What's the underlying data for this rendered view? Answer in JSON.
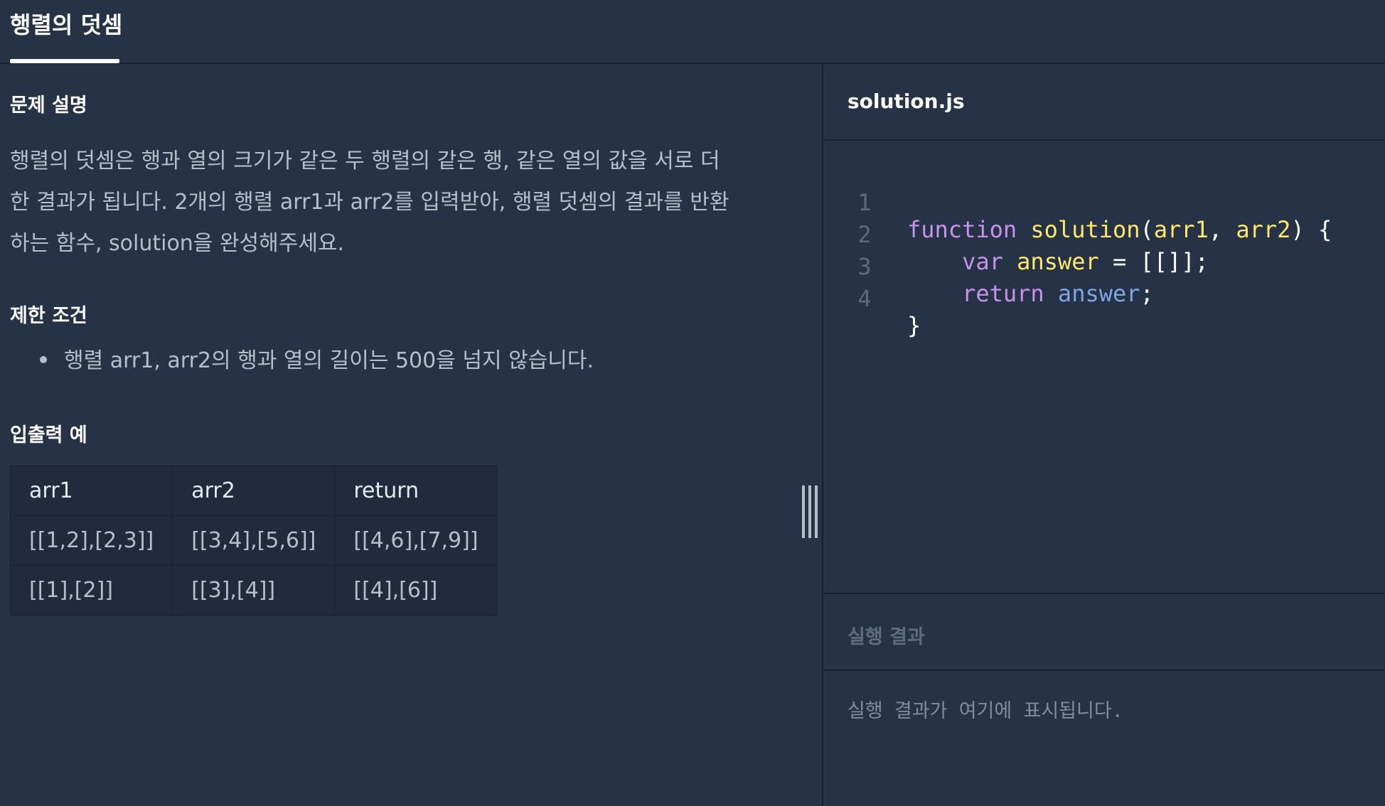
{
  "tab": {
    "label": "행렬의 덧셈"
  },
  "problem": {
    "description_heading": "문제 설명",
    "description_lines": [
      "행렬의 덧셈은 행과 열의 크기가 같은 두 행렬의 같은 행, 같은 열의 값을 서로 더",
      "한 결과가 됩니다. 2개의 행렬 arr1과 arr2를 입력받아, 행렬 덧셈의 결과를 반환",
      "하는 함수, solution을 완성해주세요."
    ],
    "constraints_heading": "제한 조건",
    "constraints": [
      "행렬 arr1, arr2의 행과 열의 길이는 500을 넘지 않습니다."
    ],
    "examples_heading": "입출력 예",
    "table": {
      "headers": [
        "arr1",
        "arr2",
        "return"
      ],
      "rows": [
        [
          "[[1,2],[2,3]]",
          "[[3,4],[5,6]]",
          "[[4,6],[7,9]]"
        ],
        [
          "[[1],[2]]",
          "[[3],[4]]",
          "[[4],[6]]"
        ]
      ]
    }
  },
  "editor": {
    "file_name": "solution.js",
    "line_numbers": [
      "1",
      "2",
      "3",
      "4"
    ],
    "code": {
      "l1_kw": "function",
      "l1_fn": "solution",
      "l1_open": "(",
      "l1_p1": "arr1",
      "l1_comma": ", ",
      "l1_p2": "arr2",
      "l1_close": ") {",
      "l2_kw": "var",
      "l2_var": "answer",
      "l2_rest": " = [[]];",
      "l3_kw": "return",
      "l3_var": "answer",
      "l3_rest": ";",
      "l4": "}"
    }
  },
  "result": {
    "heading": "실행 결과",
    "placeholder": "실행 결과가 여기에 표시됩니다."
  }
}
